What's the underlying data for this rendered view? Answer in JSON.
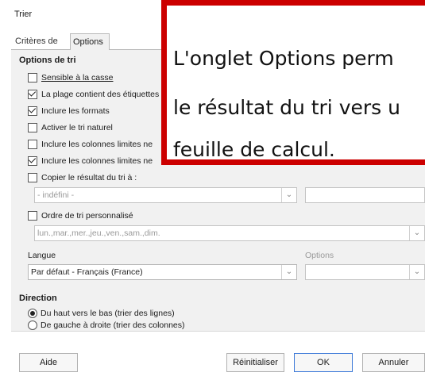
{
  "window": {
    "title": "Trier"
  },
  "tabs": [
    {
      "label": "Critères de tri",
      "active": false
    },
    {
      "label": "Options",
      "active": true
    }
  ],
  "options_section": {
    "heading": "Options de tri",
    "checkboxes": [
      {
        "label": "Sensible à la casse",
        "checked": false
      },
      {
        "label": "La plage contient des étiquettes",
        "checked": true
      },
      {
        "label": "Inclure les formats",
        "checked": true
      },
      {
        "label": "Activer le tri naturel",
        "checked": false
      },
      {
        "label": "Inclure les colonnes limites ne",
        "checked": false
      },
      {
        "label": "Inclure les colonnes limites ne",
        "checked": true
      }
    ],
    "copy_result": {
      "label": "Copier le résultat du tri à :",
      "checked": false,
      "range_value": "- indéfini -",
      "target_value": ""
    },
    "custom_order": {
      "label": "Ordre de tri personnalisé",
      "checked": false,
      "value": "lun.,mar.,mer.,jeu.,ven.,sam.,dim."
    },
    "language": {
      "label": "Langue",
      "value": "Par défaut - Français (France)"
    },
    "options": {
      "label": "Options",
      "value": ""
    }
  },
  "direction_section": {
    "heading": "Direction",
    "radios": [
      {
        "label": "Du haut vers le bas (trier des lignes)",
        "checked": true
      },
      {
        "label": "De gauche à droite (trier des colonnes)",
        "checked": false
      }
    ]
  },
  "buttons": {
    "help": "Aide",
    "reset": "Réinitialiser",
    "ok": "OK",
    "cancel": "Annuler"
  },
  "callout": {
    "lines": [
      "L'onglet Options perm",
      "le résultat du tri vers u",
      "feuille de calcul."
    ],
    "border_color": "#cc0000"
  }
}
